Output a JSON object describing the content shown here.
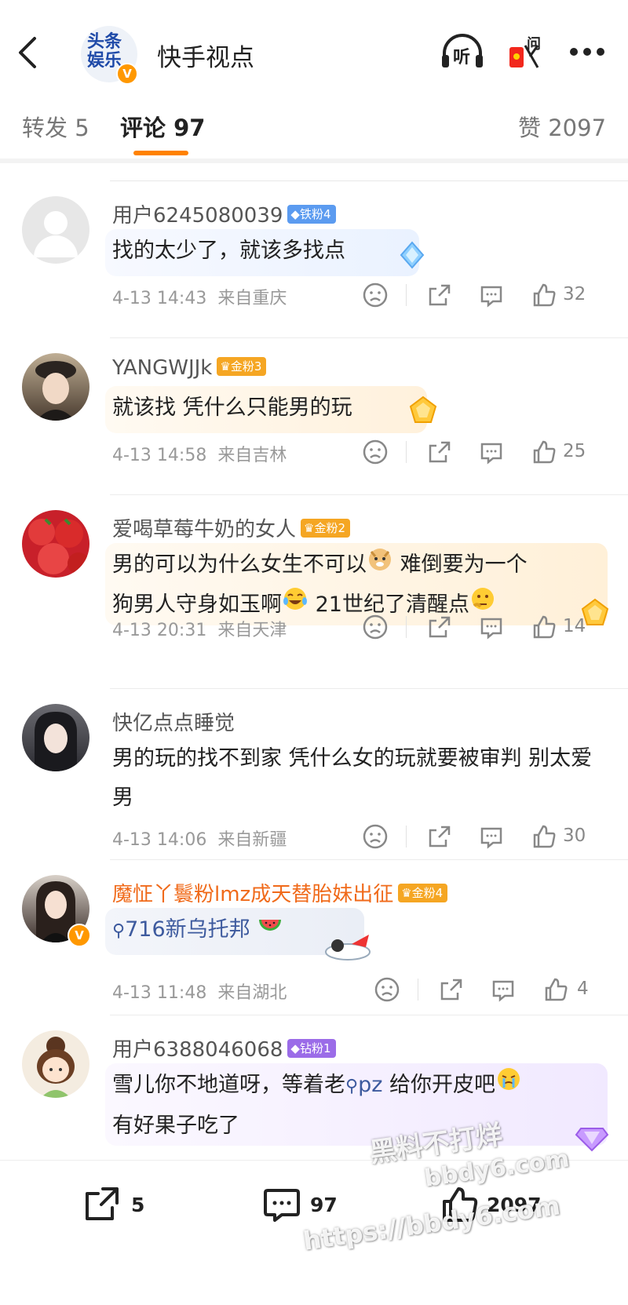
{
  "header": {
    "back_icon": "chevron-left-icon",
    "logo_text_top": "头条",
    "logo_text_bottom": "娱乐",
    "title": "快手视点",
    "listen_label": "听",
    "ask_label": "问",
    "more_icon": "more-icon"
  },
  "tabs": [
    {
      "label": "转发 5"
    },
    {
      "label": "评论 97"
    },
    {
      "label": "赞 2097"
    }
  ],
  "comments": [
    {
      "name": "用户6245080039",
      "badge": "铁粉4",
      "text": "找的太少了，就该多找点",
      "time": "4-13 14:43",
      "location": "来自重庆",
      "likes": "32"
    },
    {
      "name": "YANGWJJk",
      "badge": "金粉3",
      "text": "就该找 凭什么只能男的玩",
      "time": "4-13 14:58",
      "location": "来自吉林",
      "likes": "25"
    },
    {
      "name": "爱喝草莓牛奶的女人",
      "badge": "金粉2",
      "text_line1_a": "男的可以为什么女生不可以",
      "text_line1_b": "难倒要为一个",
      "text_line2_a": "狗男人守身如玉啊",
      "text_line2_b": "21世纪了清醒点",
      "time": "4-13 20:31",
      "location": "来自天津",
      "likes": "14"
    },
    {
      "name": "快亿点点睡觉",
      "text": "男的玩的找不到家 凭什么女的玩就要被审判 别太爱男",
      "time": "4-13 14:06",
      "location": "来自新疆",
      "likes": "30"
    },
    {
      "name": "魔怔丫鬟粉lmz成天替胎妹出征",
      "badge": "金粉4",
      "text": "716新乌托邦",
      "time": "4-13 11:48",
      "location": "来自湖北",
      "likes": "4"
    },
    {
      "name": "用户6388046068",
      "badge": "钻粉1",
      "text_a": "雪儿你不地道呀，等着老",
      "text_link": "pz",
      "text_b": "给你开皮吧",
      "text_line2": "有好果子吃了"
    }
  ],
  "bottom": {
    "repost": "5",
    "comment": "97",
    "like": "2097"
  },
  "watermark": {
    "line1": "黑料不打烊",
    "line2": "bbdy6.com",
    "line3": "https://bbdy6.com"
  },
  "colors": {
    "accent": "#ff8200",
    "name_orange": "#f06a1a",
    "badge_iron": "#5b9bf0",
    "badge_gold": "#f5a623",
    "badge_diamond": "#9b6ce8"
  }
}
